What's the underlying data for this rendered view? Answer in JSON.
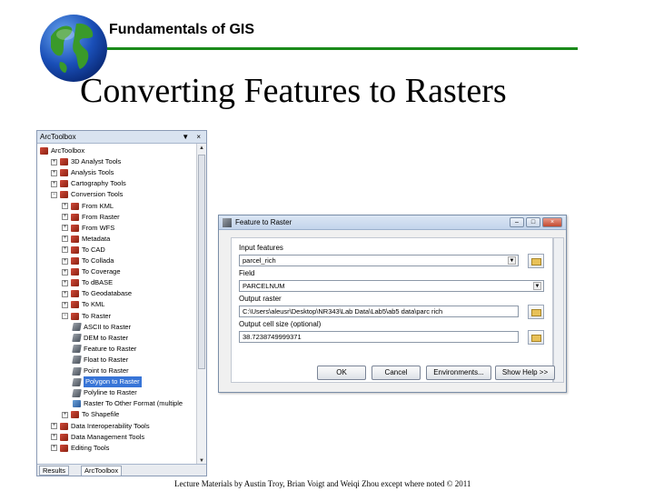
{
  "header": {
    "course_title": "Fundamentals of GIS",
    "accent_color": "#1a8a1a"
  },
  "slide": {
    "title": "Converting Features to Rasters"
  },
  "toolbox": {
    "title": "ArcToolbox",
    "controls": "▼ ×",
    "tree": [
      {
        "label": "ArcToolbox",
        "icon": "toolbox-icon",
        "expander": "",
        "indent": 0
      },
      {
        "label": "3D Analyst Tools",
        "icon": "toolbox-icon",
        "expander": "+",
        "indent": 1
      },
      {
        "label": "Analysis Tools",
        "icon": "toolbox-icon",
        "expander": "+",
        "indent": 1
      },
      {
        "label": "Cartography Tools",
        "icon": "toolbox-icon",
        "expander": "+",
        "indent": 1
      },
      {
        "label": "Conversion Tools",
        "icon": "toolbox-icon",
        "expander": "−",
        "indent": 1
      },
      {
        "label": "From KML",
        "icon": "toolset-icon",
        "expander": "+",
        "indent": 2
      },
      {
        "label": "From Raster",
        "icon": "toolset-icon",
        "expander": "+",
        "indent": 2
      },
      {
        "label": "From WFS",
        "icon": "toolset-icon",
        "expander": "+",
        "indent": 2
      },
      {
        "label": "Metadata",
        "icon": "toolset-icon",
        "expander": "+",
        "indent": 2
      },
      {
        "label": "To CAD",
        "icon": "toolset-icon",
        "expander": "+",
        "indent": 2
      },
      {
        "label": "To Collada",
        "icon": "toolset-icon",
        "expander": "+",
        "indent": 2
      },
      {
        "label": "To Coverage",
        "icon": "toolset-icon",
        "expander": "+",
        "indent": 2
      },
      {
        "label": "To dBASE",
        "icon": "toolset-icon",
        "expander": "+",
        "indent": 2
      },
      {
        "label": "To Geodatabase",
        "icon": "toolset-icon",
        "expander": "+",
        "indent": 2
      },
      {
        "label": "To KML",
        "icon": "toolset-icon",
        "expander": "+",
        "indent": 2
      },
      {
        "label": "To Raster",
        "icon": "toolset-icon",
        "expander": "−",
        "indent": 2
      },
      {
        "label": "ASCII to Raster",
        "icon": "hammer-icon",
        "expander": "",
        "indent": 3
      },
      {
        "label": "DEM to Raster",
        "icon": "hammer-icon",
        "expander": "",
        "indent": 3
      },
      {
        "label": "Feature to Raster",
        "icon": "hammer-icon",
        "expander": "",
        "indent": 3
      },
      {
        "label": "Float to Raster",
        "icon": "hammer-icon",
        "expander": "",
        "indent": 3
      },
      {
        "label": "Point to Raster",
        "icon": "hammer-icon",
        "expander": "",
        "indent": 3
      },
      {
        "label": "Polygon to Raster",
        "icon": "hammer-icon",
        "expander": "",
        "indent": 3,
        "selected": true
      },
      {
        "label": "Polyline to Raster",
        "icon": "hammer-icon",
        "expander": "",
        "indent": 3
      },
      {
        "label": "Raster To Other Format (multiple",
        "icon": "script-icon",
        "expander": "",
        "indent": 3
      },
      {
        "label": "To Shapefile",
        "icon": "toolset-icon",
        "expander": "+",
        "indent": 2
      },
      {
        "label": "Data Interoperability Tools",
        "icon": "toolbox-icon",
        "expander": "+",
        "indent": 1
      },
      {
        "label": "Data Management Tools",
        "icon": "toolbox-icon",
        "expander": "+",
        "indent": 1
      },
      {
        "label": "Editing Tools",
        "icon": "toolbox-icon",
        "expander": "+",
        "indent": 1
      }
    ],
    "tabs": [
      "Results",
      "ArcToolbox"
    ]
  },
  "dialog": {
    "title": "Feature to Raster",
    "min_label": "–",
    "max_label": "□",
    "close_label": "×",
    "fields": {
      "input_features_label": "Input features",
      "input_features_value": "parcel_rich",
      "field_label": "Field",
      "field_value": "PARCELNUM",
      "output_raster_label": "Output raster",
      "output_raster_value": "C:\\Users\\aleusr\\Desktop\\NR343\\Lab Data\\Lab5\\ab5 data\\parc rich",
      "cell_size_label": "Output cell size (optional)",
      "cell_size_value": "38.7238749999371"
    },
    "buttons": {
      "ok": "OK",
      "cancel": "Cancel",
      "environments": "Environments...",
      "show_help": "Show Help >>"
    }
  },
  "footer": {
    "credit": "Lecture Materials by Austin Troy, Brian Voigt and Weiqi Zhou except where noted © 2011"
  }
}
